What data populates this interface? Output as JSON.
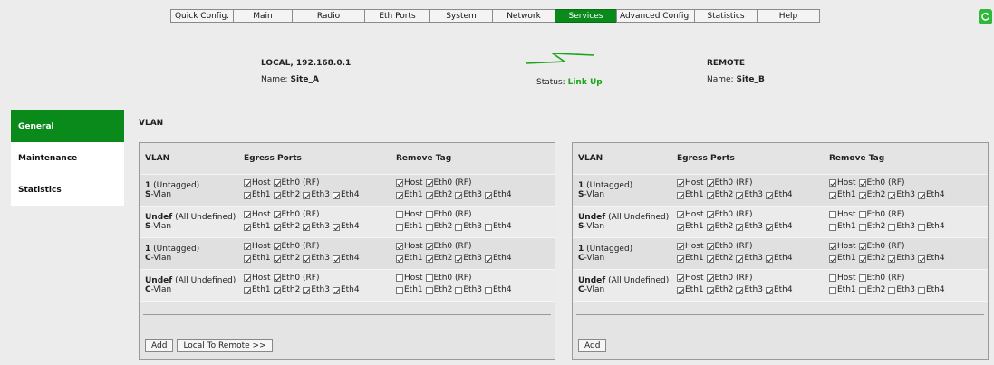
{
  "nav": {
    "tabs": [
      {
        "label": "Quick Config.",
        "active": false
      },
      {
        "label": "Main",
        "active": false
      },
      {
        "label": "Radio",
        "active": false
      },
      {
        "label": "Eth Ports",
        "active": false
      },
      {
        "label": "System",
        "active": false
      },
      {
        "label": "Network",
        "active": false
      },
      {
        "label": "Services",
        "active": true
      },
      {
        "label": "Advanced Config.",
        "active": false
      },
      {
        "label": "Statistics",
        "active": false
      },
      {
        "label": "Help",
        "active": false
      }
    ]
  },
  "header": {
    "local_title": "LOCAL, 192.168.0.1",
    "local_name_label": "Name:",
    "local_name": "Site_A",
    "status_label": "Status:",
    "status_value": "Link Up",
    "remote_title": "REMOTE",
    "remote_name_label": "Name:",
    "remote_name": "Site_B"
  },
  "sidebar": {
    "items": [
      {
        "label": "General",
        "active": true
      },
      {
        "label": "Maintenance",
        "active": false
      },
      {
        "label": "Statistics",
        "active": false
      }
    ]
  },
  "section_title": "VLAN",
  "panels": {
    "columns": {
      "vlan": "VLAN",
      "egress": "Egress Ports",
      "remove": "Remove Tag"
    },
    "port_labels": {
      "host": "Host",
      "eth0": "Eth0 (RF)",
      "eth1": "Eth1",
      "eth2": "Eth2",
      "eth3": "Eth3",
      "eth4": "Eth4"
    },
    "rows": [
      {
        "id": "1",
        "desc": "(Untagged)",
        "type_prefix": "S",
        "type_suffix": "-Vlan",
        "egress": [
          true,
          true,
          true,
          true,
          true,
          true
        ],
        "remove": [
          true,
          true,
          true,
          true,
          true,
          true
        ]
      },
      {
        "id": "Undef",
        "desc": "(All Undefined)",
        "type_prefix": "S",
        "type_suffix": "-Vlan",
        "egress": [
          true,
          true,
          true,
          true,
          true,
          true
        ],
        "remove": [
          false,
          false,
          false,
          false,
          false,
          false
        ]
      },
      {
        "id": "1",
        "desc": "(Untagged)",
        "type_prefix": "C",
        "type_suffix": "-Vlan",
        "egress": [
          true,
          true,
          true,
          true,
          true,
          true
        ],
        "remove": [
          true,
          true,
          true,
          true,
          true,
          true
        ]
      },
      {
        "id": "Undef",
        "desc": "(All Undefined)",
        "type_prefix": "C",
        "type_suffix": "-Vlan",
        "egress": [
          true,
          true,
          true,
          true,
          true,
          true
        ],
        "remove": [
          false,
          false,
          false,
          false,
          false,
          false
        ]
      }
    ],
    "local_buttons": [
      "Add",
      "Local To Remote >>"
    ],
    "remote_buttons": [
      "Add"
    ]
  },
  "colors": {
    "accent_green": "#0a8a1a",
    "status_green": "#1aa41a"
  }
}
